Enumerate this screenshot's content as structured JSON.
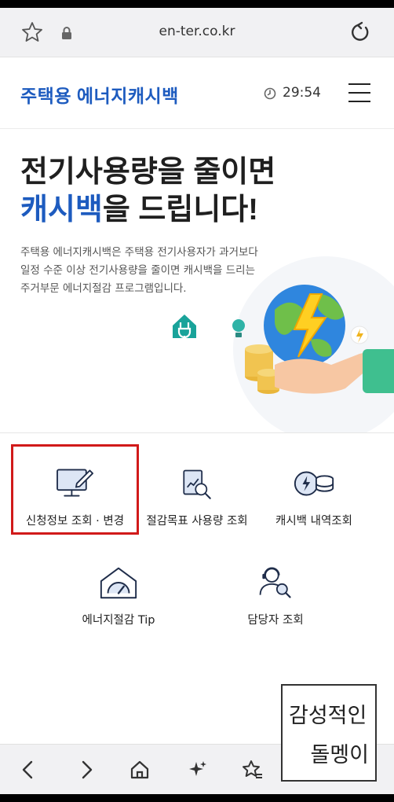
{
  "browser": {
    "url": "en-ter.co.kr"
  },
  "header": {
    "logo": "주택용 에너지캐시백",
    "timer": "29:54"
  },
  "hero": {
    "headline_line1": "전기사용량을 줄이면",
    "headline_accent": "캐시백",
    "headline_rest": "을 드립니다!",
    "description": [
      "주택용 에너지캐시백은 주택용 전기사용자가 과거보다",
      "일정 수준 이상 전기사용량을 줄이면 캐시백을 드리는",
      "주거부문 에너지절감 프로그램입니다."
    ]
  },
  "menu": {
    "items": [
      {
        "label": "신청정보 조회 · 변경",
        "icon": "monitor-pen-icon"
      },
      {
        "label": "절감목표 사용량 조회",
        "icon": "report-search-icon"
      },
      {
        "label": "캐시백 내역조회",
        "icon": "coin-stack-icon"
      },
      {
        "label": "에너지절감 Tip",
        "icon": "house-gauge-icon"
      },
      {
        "label": "담당자 조회",
        "icon": "agent-search-icon"
      }
    ]
  },
  "watermark": {
    "line1": "감성적인",
    "line2": "돌멩이"
  },
  "colors": {
    "brand_blue": "#1d5bbf",
    "highlight_red": "#d11a1a"
  }
}
